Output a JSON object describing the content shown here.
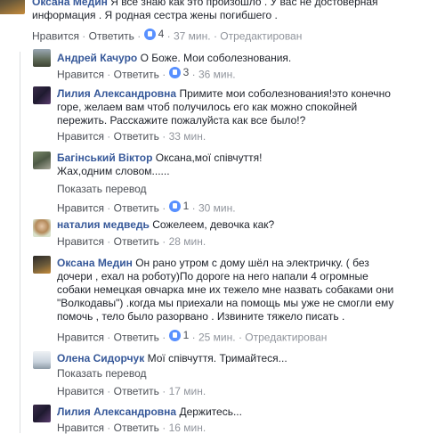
{
  "comments": [
    {
      "name": "Оксана Медин",
      "text_lines": [
        "Я все знаю как это произошло . У вас не достоверная",
        "информация . Я родная сестра жены погибшего ."
      ],
      "like": "Нравится",
      "reply": "Ответить",
      "likes": "4",
      "time": "37 мин.",
      "edited": "Отредактирован"
    },
    {
      "name": "Андрей Качуро",
      "text_lines": [
        "О Боже. Мои соболезнования."
      ],
      "like": "Нравится",
      "reply": "Ответить",
      "likes": "3",
      "time": "36 мин."
    },
    {
      "name": "Лилия Александровна",
      "text_lines": [
        "Примите мои соболезнования!это конечно",
        "горе, желаем вам чтоб получилось его как можно спокойней",
        "пережить. Расскажите пожалуйста как все было!?"
      ],
      "like": "Нравится",
      "reply": "Ответить",
      "time": "33 мин."
    },
    {
      "name": "Багінський Віктор",
      "text_lines": [
        "Оксана,мої співчуття!",
        "Жах,одним словом......"
      ],
      "translate": "Показать перевод",
      "like": "Нравится",
      "reply": "Ответить",
      "likes": "1",
      "time": "30 мин."
    },
    {
      "name": "наталия медведь",
      "text_lines": [
        "Сожелеем, девочка как?"
      ],
      "like": "Нравится",
      "reply": "Ответить",
      "time": "28 мин."
    },
    {
      "name": "Оксана Медин",
      "text_lines": [
        "Он рано утром с дому шёл на электричку. ( без",
        "дочери , ехал на роботу)По дороге на него напали 4 огромные",
        "собаки немецкая овчарка мне их тежело мне назвать собаками они",
        "\"Волкодавы\") .когда мы приехали на помощь мы уже не смогли ему",
        "помочь , тело было разорвано . Извините тяжело писать ."
      ],
      "like": "Нравится",
      "reply": "Ответить",
      "likes": "1",
      "time": "25 мин.",
      "edited": "Отредактирован"
    },
    {
      "name": "Олена Сидорчук",
      "text_lines": [
        "Мої співчуття. Тримайтеся..."
      ],
      "translate": "Показать перевод",
      "like": "Нравится",
      "reply": "Ответить",
      "time": "17 мин."
    },
    {
      "name": "Лилия Александровна",
      "text_lines": [
        "Держитесь..."
      ],
      "like": "Нравится",
      "reply": "Ответить",
      "time": "16 мин."
    }
  ],
  "colors": {
    "name": "#365899",
    "meta": "#90949c",
    "link": "#4b4f56",
    "like_badge": "#5890ff",
    "divider": "#dddfe2"
  }
}
